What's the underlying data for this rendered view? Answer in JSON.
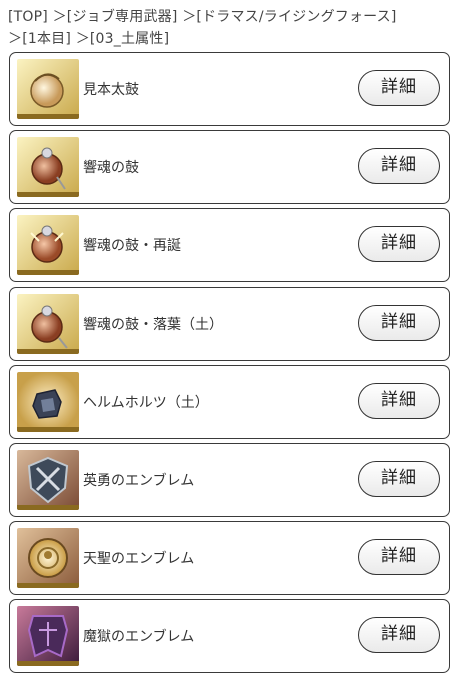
{
  "breadcrumb": {
    "items": [
      "[TOP]",
      "＞[ジョブ専用武器]",
      "＞[ドラマス/ライジングフォース]",
      "＞[1本目]",
      "＞[03_土属性]"
    ]
  },
  "items": [
    {
      "name": "見本太鼓",
      "button": "詳細",
      "icon": "drum-sample-icon"
    },
    {
      "name": "響魂の鼓",
      "button": "詳細",
      "icon": "drum-icon"
    },
    {
      "name": "響魂の鼓・再誕",
      "button": "詳細",
      "icon": "drum-reborn-icon"
    },
    {
      "name": "響魂の鼓・落葉（土）",
      "button": "詳細",
      "icon": "drum-fallen-leaves-icon"
    },
    {
      "name": "ヘルムホルツ（土）",
      "button": "詳細",
      "icon": "helmholtz-cube-icon"
    },
    {
      "name": "英勇のエンブレム",
      "button": "詳細",
      "icon": "hero-emblem-icon"
    },
    {
      "name": "天聖のエンブレム",
      "button": "詳細",
      "icon": "holy-emblem-icon"
    },
    {
      "name": "魔獄のエンブレム",
      "button": "詳細",
      "icon": "demon-emblem-icon"
    }
  ]
}
